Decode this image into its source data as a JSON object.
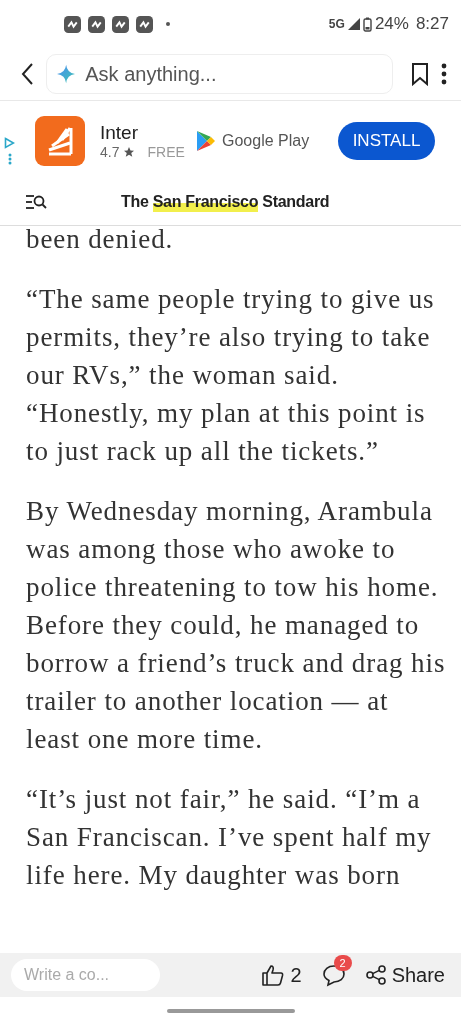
{
  "status_bar": {
    "network": "5G",
    "battery": "24%",
    "time": "8:27"
  },
  "browser_bar": {
    "placeholder": "Ask anything..."
  },
  "ad": {
    "app_name": "Inter",
    "rating": "4.7",
    "price": "FREE",
    "store": "Google Play",
    "button": "INSTALL"
  },
  "site_header": {
    "title_before": "The ",
    "title_highlight": "San Francisco",
    "title_after": " Standard"
  },
  "article": {
    "paragraphs": [
      "been denied.",
      "“The same people trying to give us permits, they’re also trying to take our RVs,” the woman said. “Honestly, my plan at this point is to just rack up all the tickets.”",
      "By Wednesday morning, Arambula was among those who awoke to police threatening to tow his home. Before they could, he managed to borrow a friend’s truck and drag his trailer to another location — at least one more time.",
      "“It’s just not fair,” he said. “I’m a San Franciscan. I’ve spent half my life here. My daughter was born"
    ]
  },
  "bottom_bar": {
    "comment_placeholder": "Write a co...",
    "likes": "2",
    "comments_badge": "2",
    "share": "Share"
  }
}
